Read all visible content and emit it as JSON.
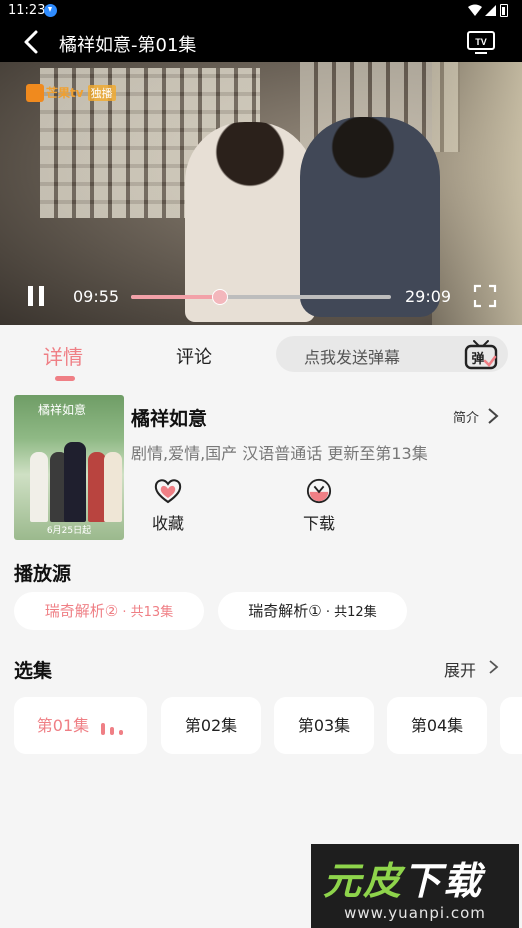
{
  "status_bar": {
    "time": "11:23"
  },
  "header": {
    "title": "橘祥如意-第01集",
    "tv_icon": "tv-cast-icon"
  },
  "player": {
    "logo_text": "芒果tv",
    "logo_badge": "独播",
    "current_time": "09:55",
    "total_time": "29:09",
    "progress": 0.342
  },
  "tabs": {
    "details": "详情",
    "comments": "评论"
  },
  "danmu": {
    "placeholder": "点我发送弹幕",
    "icon_text": "弹"
  },
  "show": {
    "title": "橘祥如意",
    "intro_label": "简介",
    "meta": "剧情,爱情,国产 汉语普通话 更新至第13集",
    "poster_date": "6月25日起",
    "poster_title": "橘祥如意",
    "actions": [
      {
        "label": "收藏",
        "icon": "heart-icon"
      },
      {
        "label": "下载",
        "icon": "download-icon"
      }
    ]
  },
  "sources_section": {
    "title": "播放源",
    "items": [
      {
        "name": "瑞奇解析②",
        "count": " · 共13集",
        "active": true
      },
      {
        "name": "瑞奇解析①",
        "count": " · 共12集",
        "active": false
      }
    ]
  },
  "episodes_section": {
    "title": "选集",
    "expand_label": "展开",
    "items": [
      "第01集",
      "第02集",
      "第03集",
      "第04集"
    ],
    "active_index": 0
  },
  "watermark": {
    "line1_a": "元皮",
    "line1_b": "下载",
    "line2": "www.yuanpi.com"
  },
  "colors": {
    "accent": "#ef7f85",
    "background": "#f5f5f5",
    "card": "#ffffff"
  }
}
